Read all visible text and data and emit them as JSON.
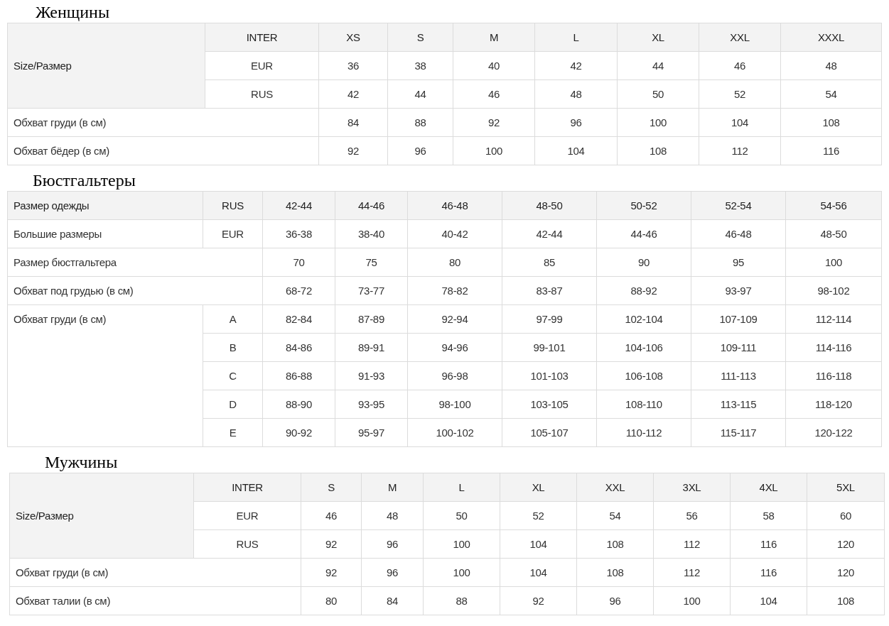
{
  "sections": [
    {
      "title": "Женщины",
      "groups": [
        {
          "label": "Size/Размер",
          "shaded": true,
          "rows": [
            {
              "sub": "INTER",
              "shaded": true,
              "values": [
                "XS",
                "S",
                "M",
                "L",
                "XL",
                "XXL",
                "XXXL"
              ]
            },
            {
              "sub": "EUR",
              "shaded": false,
              "values": [
                "36",
                "38",
                "40",
                "42",
                "44",
                "46",
                "48"
              ]
            },
            {
              "sub": "RUS",
              "shaded": false,
              "values": [
                "42",
                "44",
                "46",
                "48",
                "50",
                "52",
                "54"
              ]
            }
          ]
        },
        {
          "label": "Обхват груди (в см)",
          "shaded": false,
          "rows": [
            {
              "shaded": false,
              "values": [
                "84",
                "88",
                "92",
                "96",
                "100",
                "104",
                "108"
              ]
            }
          ]
        },
        {
          "label": "Обхват бёдер (в см)",
          "shaded": false,
          "rows": [
            {
              "shaded": false,
              "values": [
                "92",
                "96",
                "100",
                "104",
                "108",
                "112",
                "116"
              ]
            }
          ]
        }
      ]
    },
    {
      "title": "Бюстгальтеры",
      "groups": [
        {
          "label": "Размер одежды",
          "shaded": true,
          "rows": [
            {
              "sub": "RUS",
              "shaded": true,
              "values": [
                "42-44",
                "44-46",
                "46-48",
                "48-50",
                "50-52",
                "52-54",
                "54-56"
              ]
            }
          ]
        },
        {
          "label": "Большие размеры",
          "shaded": false,
          "rows": [
            {
              "sub": "EUR",
              "shaded": false,
              "values": [
                "36-38",
                "38-40",
                "40-42",
                "42-44",
                "44-46",
                "46-48",
                "48-50"
              ]
            }
          ]
        },
        {
          "label": "Размер бюстгальтера",
          "shaded": false,
          "rows": [
            {
              "shaded": false,
              "values": [
                "70",
                "75",
                "80",
                "85",
                "90",
                "95",
                "100"
              ]
            }
          ]
        },
        {
          "label": "Обхват под грудью (в см)",
          "shaded": false,
          "rows": [
            {
              "shaded": false,
              "values": [
                "68-72",
                "73-77",
                "78-82",
                "83-87",
                "88-92",
                "93-97",
                "98-102"
              ]
            }
          ]
        },
        {
          "label": "Обхват груди (в см)",
          "shaded": false,
          "rows": [
            {
              "sub": "A",
              "shaded": false,
              "values": [
                "82-84",
                "87-89",
                "92-94",
                "97-99",
                "102-104",
                "107-109",
                "112-114"
              ]
            },
            {
              "sub": "B",
              "shaded": false,
              "values": [
                "84-86",
                "89-91",
                "94-96",
                "99-101",
                "104-106",
                "109-111",
                "114-116"
              ]
            },
            {
              "sub": "C",
              "shaded": false,
              "values": [
                "86-88",
                "91-93",
                "96-98",
                "101-103",
                "106-108",
                "111-113",
                "116-118"
              ]
            },
            {
              "sub": "D",
              "shaded": false,
              "values": [
                "88-90",
                "93-95",
                "98-100",
                "103-105",
                "108-110",
                "113-115",
                "118-120"
              ]
            },
            {
              "sub": "E",
              "shaded": false,
              "values": [
                "90-92",
                "95-97",
                "100-102",
                "105-107",
                "110-112",
                "115-117",
                "120-122"
              ]
            }
          ]
        }
      ]
    },
    {
      "title": "Мужчины",
      "groups": [
        {
          "label": "Size/Размер",
          "shaded": true,
          "rows": [
            {
              "sub": "INTER",
              "shaded": true,
              "values": [
                "S",
                "M",
                "L",
                "XL",
                "XXL",
                "3XL",
                "4XL",
                "5XL"
              ]
            },
            {
              "sub": "EUR",
              "shaded": false,
              "values": [
                "46",
                "48",
                "50",
                "52",
                "54",
                "56",
                "58",
                "60"
              ]
            },
            {
              "sub": "RUS",
              "shaded": false,
              "values": [
                "92",
                "96",
                "100",
                "104",
                "108",
                "112",
                "116",
                "120"
              ]
            }
          ]
        },
        {
          "label": "Обхват груди (в см)",
          "shaded": false,
          "rows": [
            {
              "shaded": false,
              "values": [
                "92",
                "96",
                "100",
                "104",
                "108",
                "112",
                "116",
                "120"
              ]
            }
          ]
        },
        {
          "label": "Обхват талии (в см)",
          "shaded": false,
          "rows": [
            {
              "shaded": false,
              "values": [
                "80",
                "84",
                "88",
                "92",
                "96",
                "100",
                "104",
                "108"
              ]
            }
          ]
        }
      ]
    }
  ]
}
